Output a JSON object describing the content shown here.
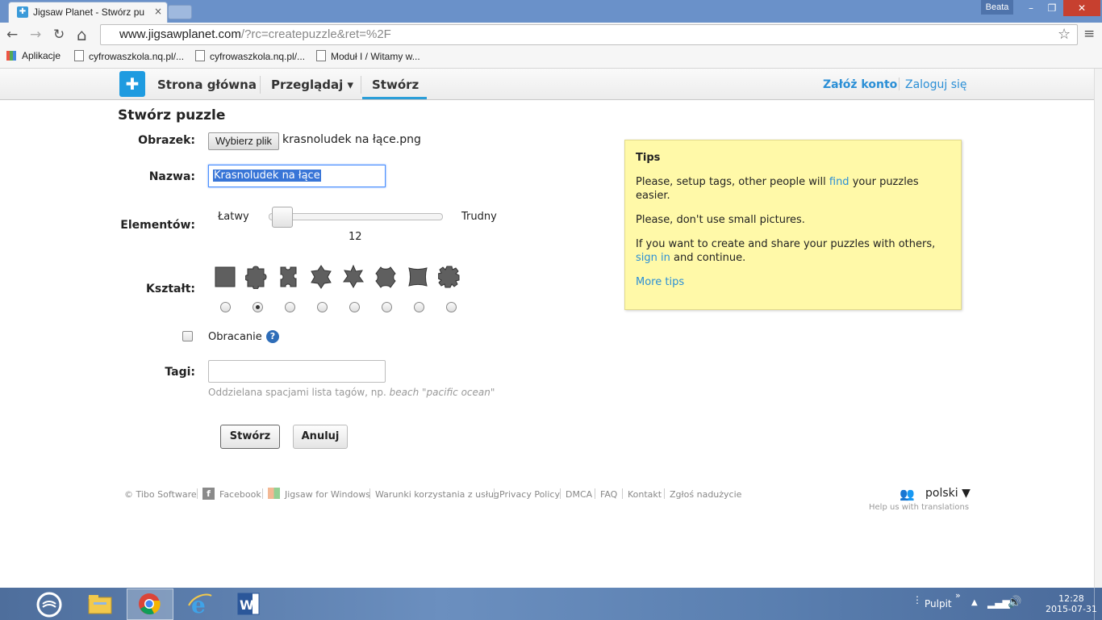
{
  "browser": {
    "tab_title": "Jigsaw Planet - Stwórz pu",
    "tab_close": "×",
    "user": "Beata",
    "url_host": "www.jigsawplanet.com",
    "url_rest": "/?rc=createpuzzle&ret=%2F",
    "window_min": "–",
    "window_max": "❐",
    "window_close": "✕",
    "back": "←",
    "forward": "→",
    "reload": "↻",
    "home": "⌂",
    "star": "☆",
    "menu": "≡",
    "bookmarks": [
      "Aplikacje",
      "cyfrowaszkola.nq.pl/...",
      "cyfrowaszkola.nq.pl/...",
      "Moduł I / Witamy w..."
    ]
  },
  "site": {
    "nav": [
      "Strona główna",
      "Przeglądaj ▾",
      "Stwórz"
    ],
    "signup": "Załóż konto",
    "login": "Zaloguj się"
  },
  "form": {
    "title": "Stwórz puzzle",
    "image_label": "Obrazek:",
    "file_button": "Wybierz plik",
    "file_name": "krasnoludek na łące.png",
    "name_label": "Nazwa:",
    "name_value": "Krasnoludek na łące",
    "pieces_label": "Elementów:",
    "easy": "Łatwy",
    "hard": "Trudny",
    "pieces_count": "12",
    "pieces_level": 0.05,
    "shape_label": "Kształt:",
    "selected_shape": 2,
    "rotation_label": "Obracanie",
    "rotation_help": "?",
    "rotation_checked": false,
    "tags_label": "Tagi:",
    "tags_value": "",
    "tags_hint": "Oddzielana spacjami lista tagów, np.",
    "tags_hint_example": "beach \"pacific ocean\"",
    "create": "Stwórz",
    "cancel": "Anuluj"
  },
  "tips": {
    "title": "Tips",
    "tip1_a": "Please, setup tags, other people will",
    "tip1_link": "find",
    "tip1_b": "your puzzles easier.",
    "tip2": "Please, don't use small pictures.",
    "tip3_a": "If you want to create and share your puzzles with others,",
    "tip3_link": "sign in",
    "tip3_b": "and continue.",
    "more": "More tips"
  },
  "footer": {
    "links": [
      "© Tibo Software",
      "Facebook",
      "Jigsaw for Windows",
      "Warunki korzystania z usług",
      "Privacy Policy",
      "DMCA",
      "FAQ",
      "Kontakt",
      "Zgłoś nadużycie"
    ],
    "language": "polski ▼",
    "translations": "Help us with translations"
  },
  "taskbar": {
    "desktop": "Pulpit",
    "time": "12:28",
    "date": "2015-07-31"
  },
  "colors": {
    "accent": "#2b8fd6",
    "tips_bg": "#fff9a8"
  }
}
